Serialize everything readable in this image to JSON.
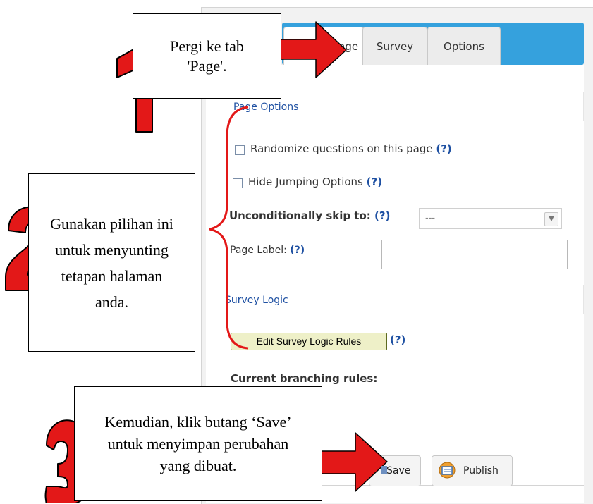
{
  "tabs": [
    "Page",
    "Survey",
    "Options"
  ],
  "page_options": {
    "header": "Page Options",
    "randomize_label": "Randomize questions on this page",
    "hide_jumping_label": "Hide Jumping Options",
    "skip_label": "Unconditionally skip to:",
    "skip_value": "---",
    "page_label": "Page Label:",
    "help": "(?)"
  },
  "survey_logic": {
    "header": "Survey Logic",
    "edit_button": "Edit Survey Logic Rules",
    "current_rules": "Current branching rules:"
  },
  "footer": {
    "save": "Save",
    "publish": "Publish"
  },
  "callouts": {
    "one": "Pergi ke tab 'Page'.",
    "two": "Gunakan pilihan ini untuk menyunting tetapan halaman anda.",
    "three": "Kemudian, klik butang ‘Save’ untuk menyimpan perubahan yang dibuat."
  },
  "step_numbers": [
    "1",
    "2",
    "3"
  ],
  "colors": {
    "accent_red": "#e31818",
    "tab_blue": "#35a1dd",
    "link_blue": "#1e50a2"
  }
}
